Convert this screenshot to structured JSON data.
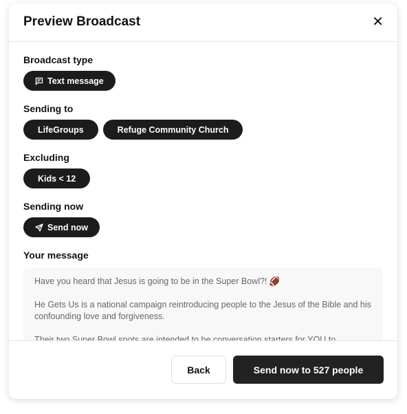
{
  "dialog": {
    "title": "Preview Broadcast",
    "close_icon": "x-icon"
  },
  "broadcast_type": {
    "label": "Broadcast type",
    "value": "Text message",
    "icon": "message-square-icon"
  },
  "sending_to": {
    "label": "Sending to",
    "items": [
      "LifeGroups",
      "Refuge Community Church"
    ]
  },
  "excluding": {
    "label": "Excluding",
    "items": [
      "Kids < 12"
    ]
  },
  "sending_now": {
    "label": "Sending now",
    "value": "Send now",
    "icon": "send-icon"
  },
  "message": {
    "label": "Your message",
    "paragraphs": [
      "Have you heard that Jesus is going to be in the Super Bowl?! 🏈",
      "He Gets Us is a national campaign reintroducing people to the Jesus of the Bible and his confounding love and forgiveness.",
      "Their two Super Bowl spots are intended to be conversation starters for YOU to"
    ]
  },
  "footer": {
    "back": "Back",
    "send": "Send now to 527 people"
  }
}
